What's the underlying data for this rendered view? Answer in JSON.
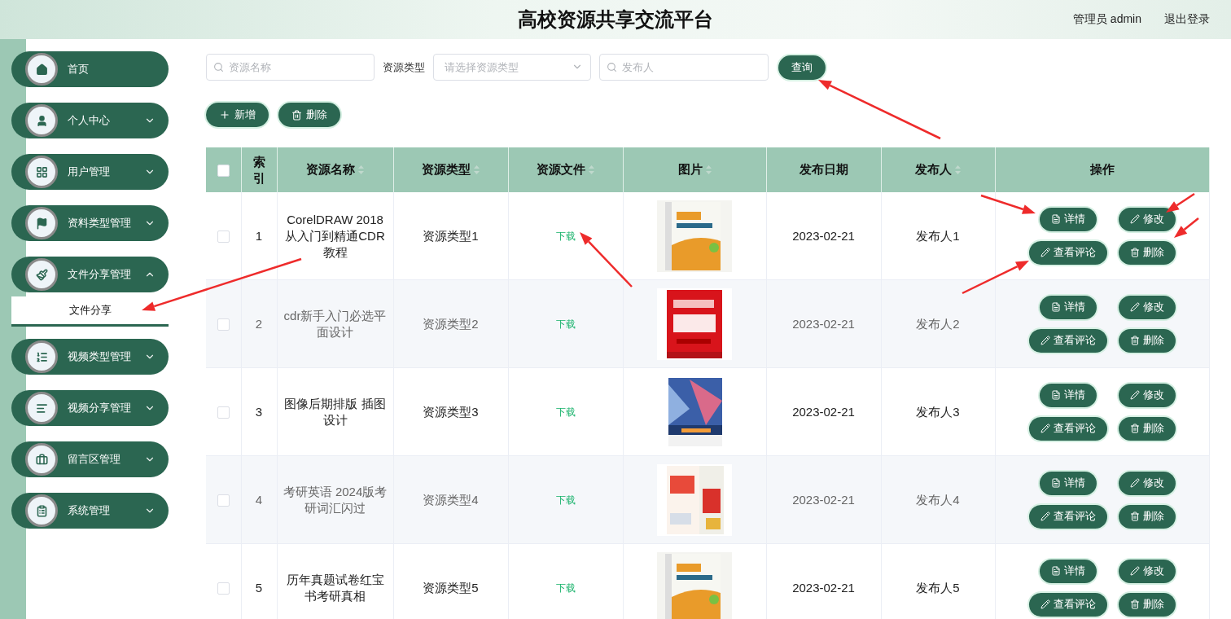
{
  "header": {
    "title": "高校资源共享交流平台",
    "user": "管理员 admin",
    "logout": "退出登录"
  },
  "sidebar": {
    "items": [
      {
        "label": "首页"
      },
      {
        "label": "个人中心",
        "expanded": false
      },
      {
        "label": "用户管理",
        "expanded": false
      },
      {
        "label": "资料类型管理",
        "expanded": false
      },
      {
        "label": "文件分享管理",
        "expanded": true,
        "children": [
          {
            "label": "文件分享",
            "selected": true
          }
        ]
      },
      {
        "label": "视频类型管理",
        "expanded": false
      },
      {
        "label": "视频分享管理",
        "expanded": false
      },
      {
        "label": "留言区管理",
        "expanded": false
      },
      {
        "label": "系统管理",
        "expanded": false
      }
    ]
  },
  "search": {
    "name_placeholder": "资源名称",
    "type_label": "资源类型",
    "type_placeholder": "请选择资源类型",
    "publisher_placeholder": "发布人",
    "query_button": "查询"
  },
  "actions": {
    "add": "新增",
    "delete": "删除"
  },
  "table": {
    "select_all_checked": false,
    "columns": [
      {
        "label": "索引",
        "sortable": false
      },
      {
        "label": "资源名称",
        "sortable": true
      },
      {
        "label": "资源类型",
        "sortable": true
      },
      {
        "label": "资源文件",
        "sortable": true
      },
      {
        "label": "图片",
        "sortable": true
      },
      {
        "label": "发布日期",
        "sortable": false
      },
      {
        "label": "发布人",
        "sortable": true
      },
      {
        "label": "操作",
        "sortable": false
      }
    ],
    "rows": [
      {
        "index": "1",
        "name": "CorelDRAW 2018 从入门到精通CDR教程",
        "type": "资源类型1",
        "file": "下载",
        "image": {
          "kind": "picture"
        },
        "date": "2023-02-21",
        "publisher": "发布人1",
        "checked": false,
        "buttons": [
          "详情",
          "修改",
          "查看评论",
          "删除"
        ]
      },
      {
        "index": "2",
        "name": "cdr新手入门必选平面设计",
        "type": "资源类型2",
        "file": "下载",
        "image": {
          "kind": "picture"
        },
        "date": "2023-02-21",
        "publisher": "发布人2",
        "checked": false,
        "buttons": [
          "详情",
          "修改",
          "查看评论",
          "删除"
        ]
      },
      {
        "index": "3",
        "name": "图像后期排版 插图设计",
        "type": "资源类型3",
        "file": "下载",
        "image": {
          "kind": "picture"
        },
        "date": "2023-02-21",
        "publisher": "发布人3",
        "checked": false,
        "buttons": [
          "详情",
          "修改",
          "查看评论",
          "删除"
        ]
      },
      {
        "index": "4",
        "name": "考研英语 2024版考研词汇闪过",
        "type": "资源类型4",
        "file": "下载",
        "image": {
          "kind": "picture"
        },
        "date": "2023-02-21",
        "publisher": "发布人4",
        "checked": false,
        "buttons": [
          "详情",
          "修改",
          "查看评论",
          "删除"
        ]
      },
      {
        "index": "5",
        "name": "历年真题试卷红宝书考研真相",
        "type": "资源类型5",
        "file": "下载",
        "image": {
          "kind": "picture"
        },
        "date": "2023-02-21",
        "publisher": "发布人5",
        "checked": false,
        "buttons": [
          "详情",
          "修改",
          "查看评论",
          "删除"
        ]
      }
    ]
  }
}
